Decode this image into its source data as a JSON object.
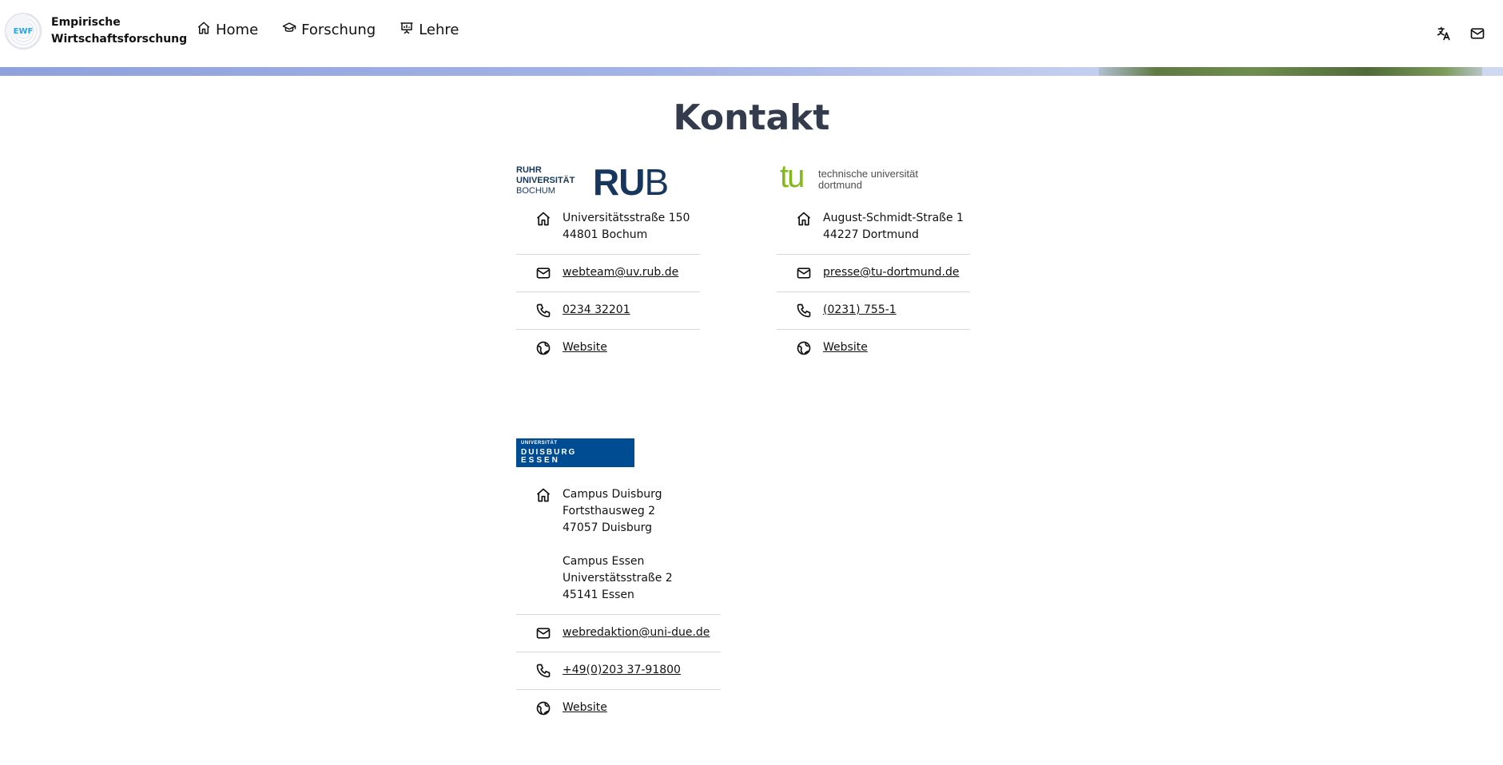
{
  "header": {
    "logo_text": "EWF",
    "brand_title": "Empirische Wirtschaftsforschung",
    "nav": [
      {
        "label": "Home",
        "icon": "home-icon"
      },
      {
        "label": "Forschung",
        "icon": "graduation-cap-icon"
      },
      {
        "label": "Lehre",
        "icon": "presentation-icon"
      }
    ],
    "actions": [
      {
        "name": "language-toggle",
        "icon": "translate-icon"
      },
      {
        "name": "contact-mail",
        "icon": "mail-icon"
      }
    ]
  },
  "main": {
    "title": "Kontakt",
    "cards": [
      {
        "university": "Ruhr-Universität Bochum",
        "logo": {
          "line1": "RUHR",
          "line2": "UNIVERSITÄT",
          "line3": "BOCHUM",
          "mark_a": "RU",
          "mark_b": "B"
        },
        "address": [
          "Universitätsstraße 150",
          "44801 Bochum"
        ],
        "email": "webteam@uv.rub.de",
        "phone": "0234 32201",
        "website": "Website"
      },
      {
        "university": "Technische Universität Dortmund",
        "logo": {
          "mark": "tu",
          "line1": "technische universität",
          "line2": "dortmund"
        },
        "address": [
          "August-Schmidt-Straße 1",
          "44227 Dortmund"
        ],
        "email": "presse@tu-dortmund.de",
        "phone": "(0231) 755-1",
        "website": "Website"
      },
      {
        "university": "Universität Duisburg-Essen",
        "logo": {
          "line1": "UNIVERSITÄT",
          "line2": "DUISBURG",
          "line3": "ESSEN"
        },
        "address_a": [
          "Campus Duisburg",
          "Fortsthausweg 2",
          "47057 Duisburg"
        ],
        "address_b": [
          "Campus Essen",
          "Universtätsstraße 2",
          "45141 Essen"
        ],
        "email": "webredaktion@uni-due.de",
        "phone": "+49(0)203 37-91800",
        "website": "Website"
      }
    ]
  },
  "colors": {
    "title": "#343b4d",
    "rub_blue": "#17365d",
    "tu_green": "#83b81a",
    "ude_blue": "#004c93",
    "banner": "#8ea1dd"
  }
}
